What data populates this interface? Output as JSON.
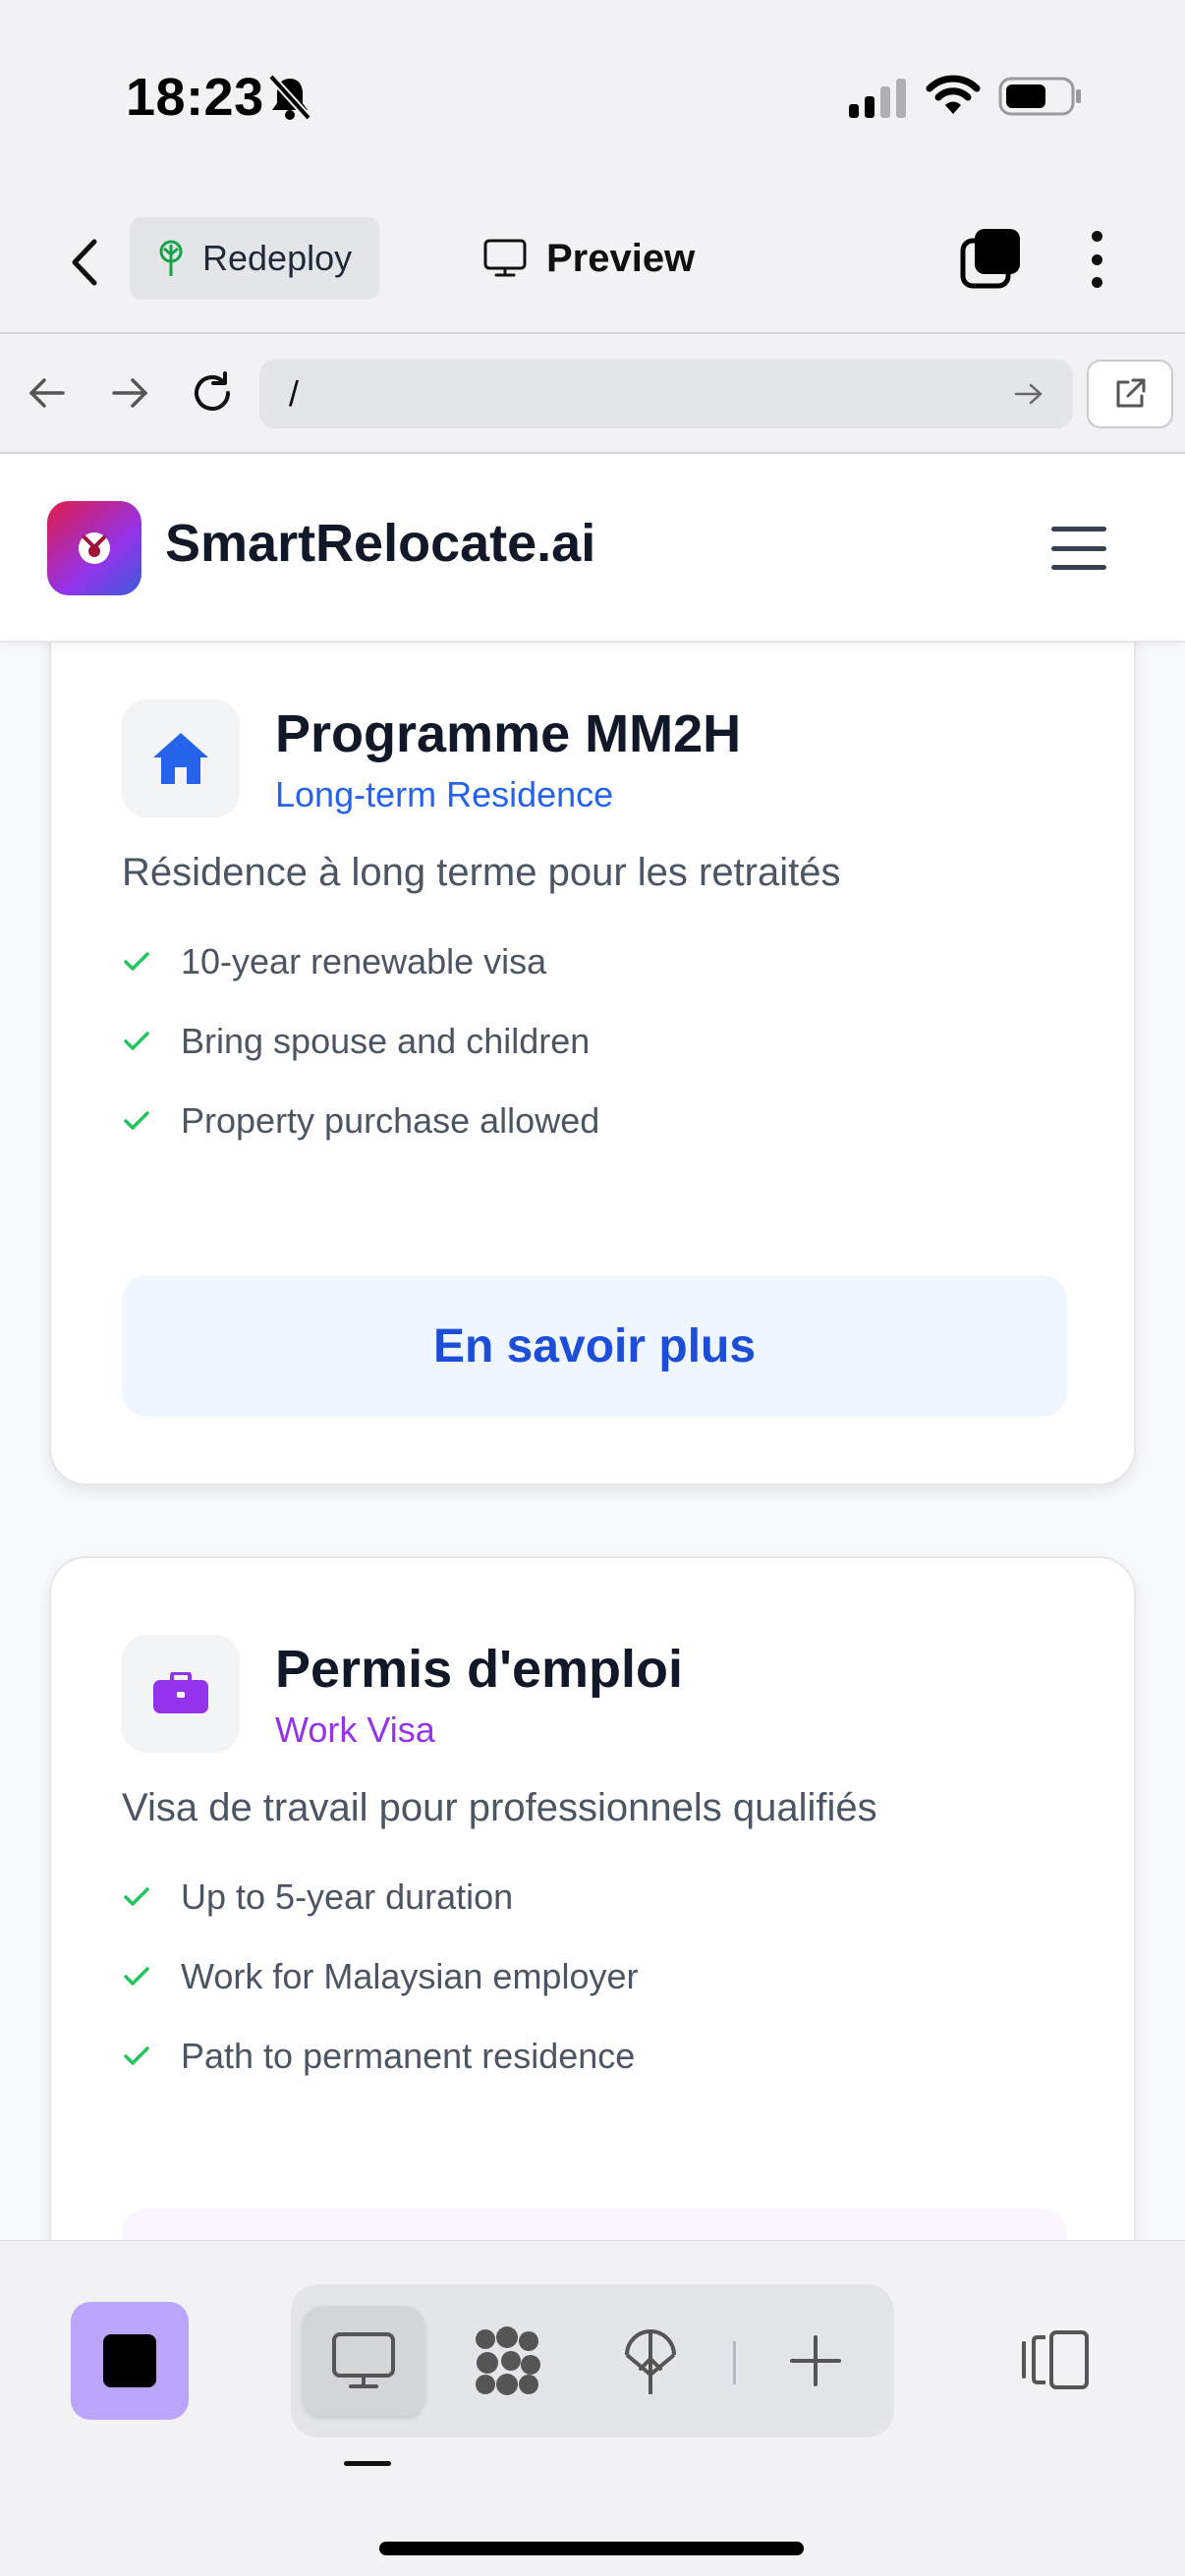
{
  "status_bar": {
    "time": "18:23"
  },
  "app_header": {
    "redeploy_label": "Redeploy",
    "preview_label": "Preview"
  },
  "url_bar": {
    "value": "/"
  },
  "site": {
    "name": "SmartRelocate.ai"
  },
  "cards": [
    {
      "title": "Programme MM2H",
      "subtitle": "Long-term Residence",
      "subtitle_color": "#2563eb",
      "icon": "home-icon",
      "description": "Résidence à long terme pour les retraités",
      "features": [
        "10-year renewable visa",
        "Bring spouse and children",
        "Property purchase allowed"
      ],
      "cta": "En savoir plus"
    },
    {
      "title": "Permis d'emploi",
      "subtitle": "Work Visa",
      "subtitle_color": "#9333ea",
      "icon": "briefcase-icon",
      "description": "Visa de travail pour professionnels qualifiés",
      "features": [
        "Up to 5-year duration",
        "Work for Malaysian employer",
        "Path to permanent residence"
      ],
      "cta": ""
    }
  ],
  "colors": {
    "check": "#22c55e",
    "agent_button": "#b9a6fb",
    "brand_gradient": [
      "#e11d48",
      "#9333ea",
      "#3b5bdb"
    ]
  }
}
